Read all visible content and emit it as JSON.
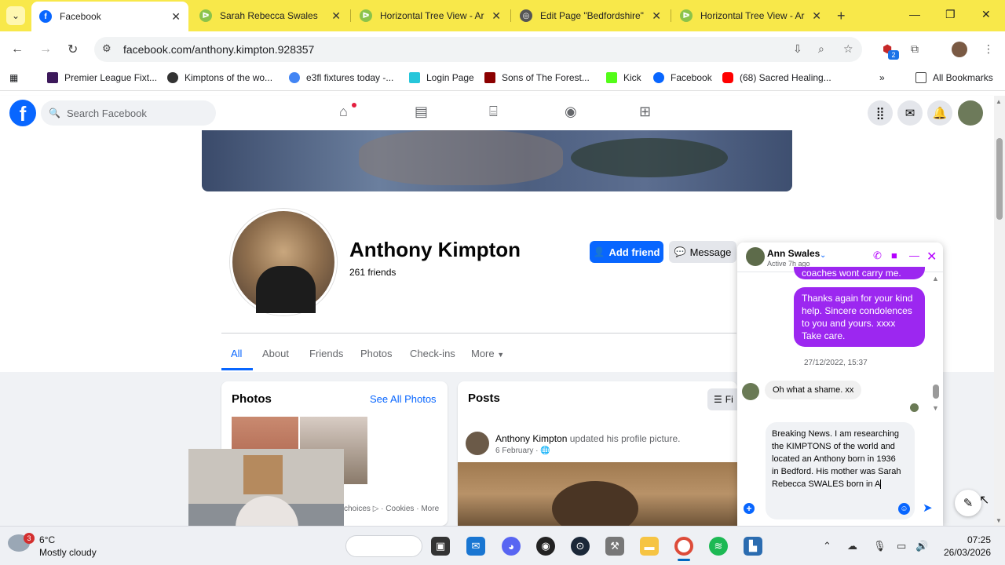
{
  "browser": {
    "tabs": [
      {
        "title": "Facebook",
        "active": true
      },
      {
        "title": "Sarah Rebecca Swales",
        "active": false
      },
      {
        "title": "Horizontal Tree View - Ar",
        "active": false
      },
      {
        "title": "Edit Page \"Bedfordshire\"",
        "active": false
      },
      {
        "title": "Horizontal Tree View - Ar",
        "active": false
      }
    ],
    "url": "facebook.com/anthony.kimpton.928357",
    "extension_badge": "2",
    "bookmarks": [
      "Premier League Fixt...",
      "Kimptons of the wo...",
      "e3fl fixtures today -...",
      "Login Page",
      "Sons of The Forest...",
      "Kick",
      "Facebook",
      "(68) Sacred Healing..."
    ],
    "all_bookmarks": "All Bookmarks",
    "colors": {
      "tabbar": "#f8e84a",
      "accent": "#0866ff"
    }
  },
  "facebook": {
    "search_placeholder": "Search Facebook",
    "profile": {
      "name": "Anthony Kimpton",
      "friends": "261 friends",
      "add_friend": "Add friend",
      "message": "Message"
    },
    "tabs": [
      "All",
      "About",
      "Friends",
      "Photos",
      "Check-ins",
      "More"
    ],
    "photos_card": {
      "title": "Photos",
      "see_all": "See All Photos"
    },
    "footer": {
      "choices": "choices",
      "cookies": "Cookies",
      "sep": "·",
      "more": "More"
    },
    "posts_card": {
      "title": "Posts",
      "filter_label": "Fi",
      "post_author": "Anthony Kimpton",
      "post_action": "updated his profile picture.",
      "post_date": "6 February"
    }
  },
  "chat": {
    "contact_name": "Ann Swales",
    "contact_status": "Active 7h ago",
    "msg_partial": "coaches wont carry me.",
    "msg_sent": "Thanks again for your kind help. Sincere condolences to you and yours. xxxx Take care.",
    "timestamp": "27/12/2022, 15:37",
    "msg_received": "Oh what a shame. xx",
    "draft": "Breaking News. I am researching the KIMPTONS of the world and located an Anthony born in 1936 in Bedford. His mother was Sarah Rebecca SWALES born in A"
  },
  "taskbar": {
    "weather_temp": "6°C",
    "weather_desc": "Mostly cloudy",
    "weather_badge": "3",
    "time": "07:25",
    "date": "26/03/2026"
  }
}
